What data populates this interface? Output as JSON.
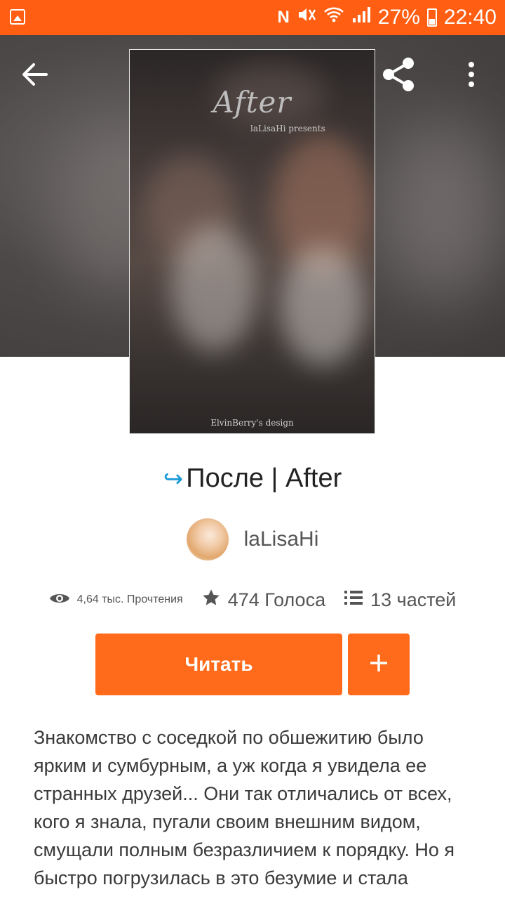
{
  "status_bar": {
    "battery_percent": "27%",
    "time": "22:40",
    "network_letter": "N"
  },
  "header": {
    "back_icon": "arrow-left-icon",
    "share_icon": "share-icon",
    "more_icon": "more-vertical-icon"
  },
  "cover": {
    "title": "After",
    "subtitle": "laLisaHi presents",
    "credit": "ElvinBerry's design"
  },
  "story": {
    "title_emoji": "↪",
    "title": "После | After",
    "author": "laLisaHi"
  },
  "stats": {
    "reads": "4,64 тыс. Прочтения",
    "votes": "474 Голоса",
    "parts": "13 частей"
  },
  "actions": {
    "read_label": "Читать",
    "add_label": "+"
  },
  "description": "Знакомство с соседкой по обшежитию было ярким и сумбурным, а уж когда я увидела ее странных друзей... Они так отличались от всех, кого я знала, пугали своим внешним видом, смущали полным безразличием к порядку. Но я быстро погрузилась в это безумие и стала",
  "colors": {
    "accent": "#ff6b1a",
    "status_bar": "#ff5e13",
    "emoji_blue": "#1a9ad6"
  }
}
